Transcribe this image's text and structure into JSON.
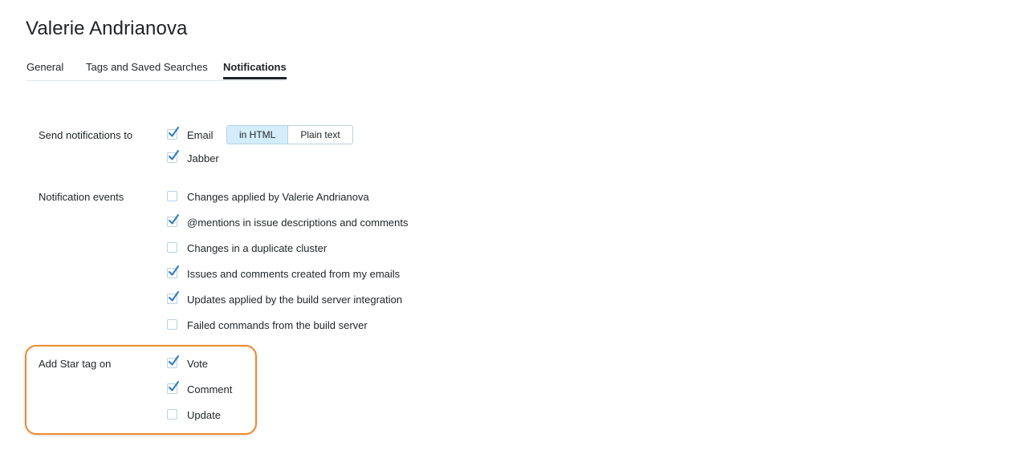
{
  "page": {
    "title": "Valerie Andrianova"
  },
  "tabs": [
    {
      "label": "General",
      "active": false
    },
    {
      "label": "Tags and Saved Searches",
      "active": false
    },
    {
      "label": "Notifications",
      "active": true
    }
  ],
  "send_notifications": {
    "label": "Send notifications to",
    "email": {
      "label": "Email",
      "checked": true
    },
    "format": {
      "html_label": "in HTML",
      "plain_label": "Plain text",
      "selected": "in HTML"
    },
    "jabber": {
      "label": "Jabber",
      "checked": true
    }
  },
  "notification_events": {
    "label": "Notification events",
    "items": [
      {
        "label": "Changes applied by Valerie Andrianova",
        "checked": false
      },
      {
        "label": "@mentions in issue descriptions and comments",
        "checked": true
      },
      {
        "label": "Changes in a duplicate cluster",
        "checked": false
      },
      {
        "label": "Issues and comments created from my emails",
        "checked": true
      },
      {
        "label": "Updates applied by the build server integration",
        "checked": true
      },
      {
        "label": "Failed commands from the build server",
        "checked": false
      }
    ]
  },
  "star_tag": {
    "label": "Add Star tag on",
    "items": [
      {
        "label": "Vote",
        "checked": true
      },
      {
        "label": "Comment",
        "checked": true
      },
      {
        "label": "Update",
        "checked": false
      }
    ]
  },
  "colors": {
    "accent_blue": "#2c7ac0",
    "highlight_orange": "#ef8a2d",
    "selected_segment": "#d4edfa"
  },
  "icons": {
    "check": "checkmark-icon"
  }
}
